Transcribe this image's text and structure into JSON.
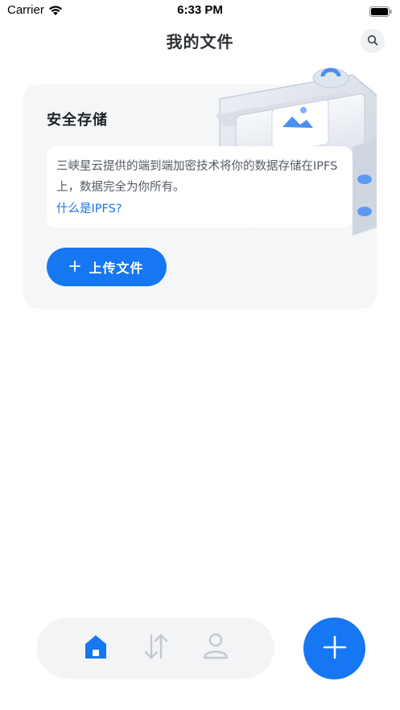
{
  "status_bar": {
    "carrier": "Carrier",
    "time": "6:33 PM"
  },
  "header": {
    "title": "我的文件",
    "search_icon": "search-icon"
  },
  "card": {
    "title": "安全存储",
    "description": "三峡星云提供的端到端加密技术将你的数据存储在IPFS上，数据完全为你所有。",
    "link": "什么是IPFS?",
    "upload_button": "上传文件"
  },
  "tabbar": {
    "tabs": [
      "home-icon",
      "transfer-icon",
      "profile-icon"
    ],
    "active": "home-icon"
  },
  "fab_icon": "plus-icon",
  "colors": {
    "accent": "#1677f2",
    "link": "#1a73e8",
    "card_bg": "#f5f6f8",
    "inactive_icon": "#c4c8ce"
  }
}
